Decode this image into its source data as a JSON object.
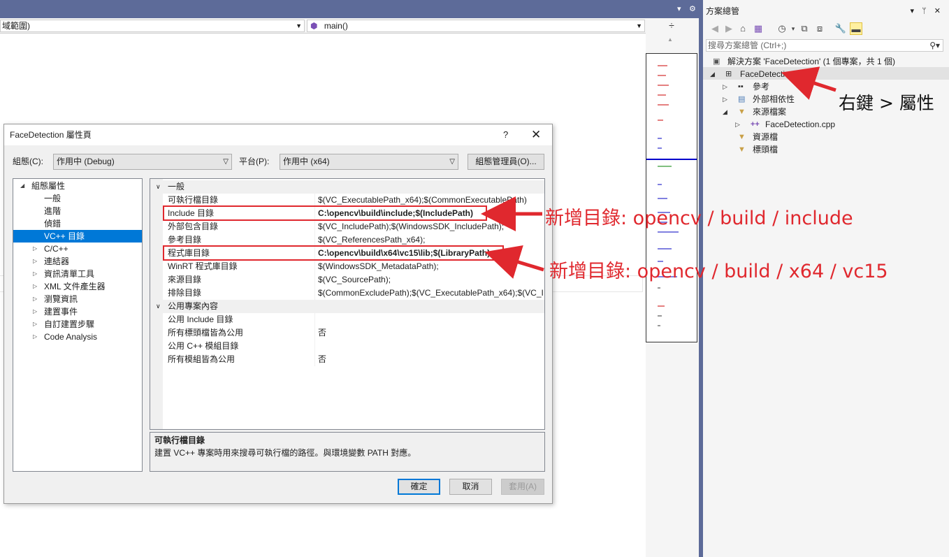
{
  "editor": {
    "scope_combo": "域範圍)",
    "member_combo": "main()",
    "member_icon": "cube-icon"
  },
  "solution_explorer": {
    "title": "方案總管",
    "title_buttons": "▾ ᛘ ✕",
    "search_placeholder": "搜尋方案總管 (Ctrl+;)",
    "tree": {
      "solution": "解決方案 'FaceDetection' (1 個專案，共 1 個)",
      "project": "FaceDetection",
      "references": "參考",
      "external_deps": "外部相依性",
      "source_files": "來源檔案",
      "source_file": "FaceDetection.cpp",
      "resource_files": "資源檔",
      "header_files": "標頭檔"
    }
  },
  "dialog": {
    "title": "FaceDetection 屬性頁",
    "help": "?",
    "close": "✕",
    "config_label": "組態(C):",
    "config_value": "作用中 (Debug)",
    "platform_label": "平台(P):",
    "platform_value": "作用中 (x64)",
    "config_manager": "組態管理員(O)...",
    "left_tree": {
      "root": "組態屬性",
      "general": "一般",
      "advanced": "進階",
      "debugging": "偵錯",
      "vcpp_dirs": "VC++ 目錄",
      "cpp": "C/C++",
      "linker": "連結器",
      "manifest": "資訊清單工具",
      "xml": "XML 文件產生器",
      "browse": "瀏覽資訊",
      "build_events": "建置事件",
      "custom_build": "自訂建置步驟",
      "code_analysis": "Code Analysis"
    },
    "grid": {
      "section_general": "一般",
      "rows": [
        {
          "name": "可執行檔目錄",
          "value": "$(VC_ExecutablePath_x64);$(CommonExecutablePath)"
        },
        {
          "name": "Include 目錄",
          "value": "C:\\opencv\\build\\include;$(IncludePath)"
        },
        {
          "name": "外部包含目錄",
          "value": "$(VC_IncludePath);$(WindowsSDK_IncludePath);"
        },
        {
          "name": "參考目錄",
          "value": "$(VC_ReferencesPath_x64);"
        },
        {
          "name": "程式庫目錄",
          "value": "C:\\opencv\\build\\x64\\vc15\\lib;$(LibraryPath)"
        },
        {
          "name": "WinRT 程式庫目錄",
          "value": "$(WindowsSDK_MetadataPath);"
        },
        {
          "name": "來源目錄",
          "value": "$(VC_SourcePath);"
        },
        {
          "name": "排除目錄",
          "value": "$(CommonExcludePath);$(VC_ExecutablePath_x64);$(VC_I"
        }
      ],
      "section_public": "公用專案內容",
      "public_rows": [
        {
          "name": "公用 Include 目錄",
          "value": ""
        },
        {
          "name": "所有標頭檔皆為公用",
          "value": "否"
        },
        {
          "name": "公用 C++ 模組目錄",
          "value": ""
        },
        {
          "name": "所有模組皆為公用",
          "value": "否"
        }
      ]
    },
    "description": {
      "title": "可執行檔目錄",
      "text": "建置 VC++ 專案時用來搜尋可執行檔的路徑。與環境變數 PATH 對應。"
    },
    "ok": "確定",
    "cancel": "取消",
    "apply": "套用(A)"
  },
  "annotations": {
    "include_note": "新增目錄: opencv / build / include",
    "lib_note": "新增目錄: opencv / build / x64 / vc15",
    "right_click_note": "右鍵 > 屬性",
    "color": "#e0282e"
  }
}
